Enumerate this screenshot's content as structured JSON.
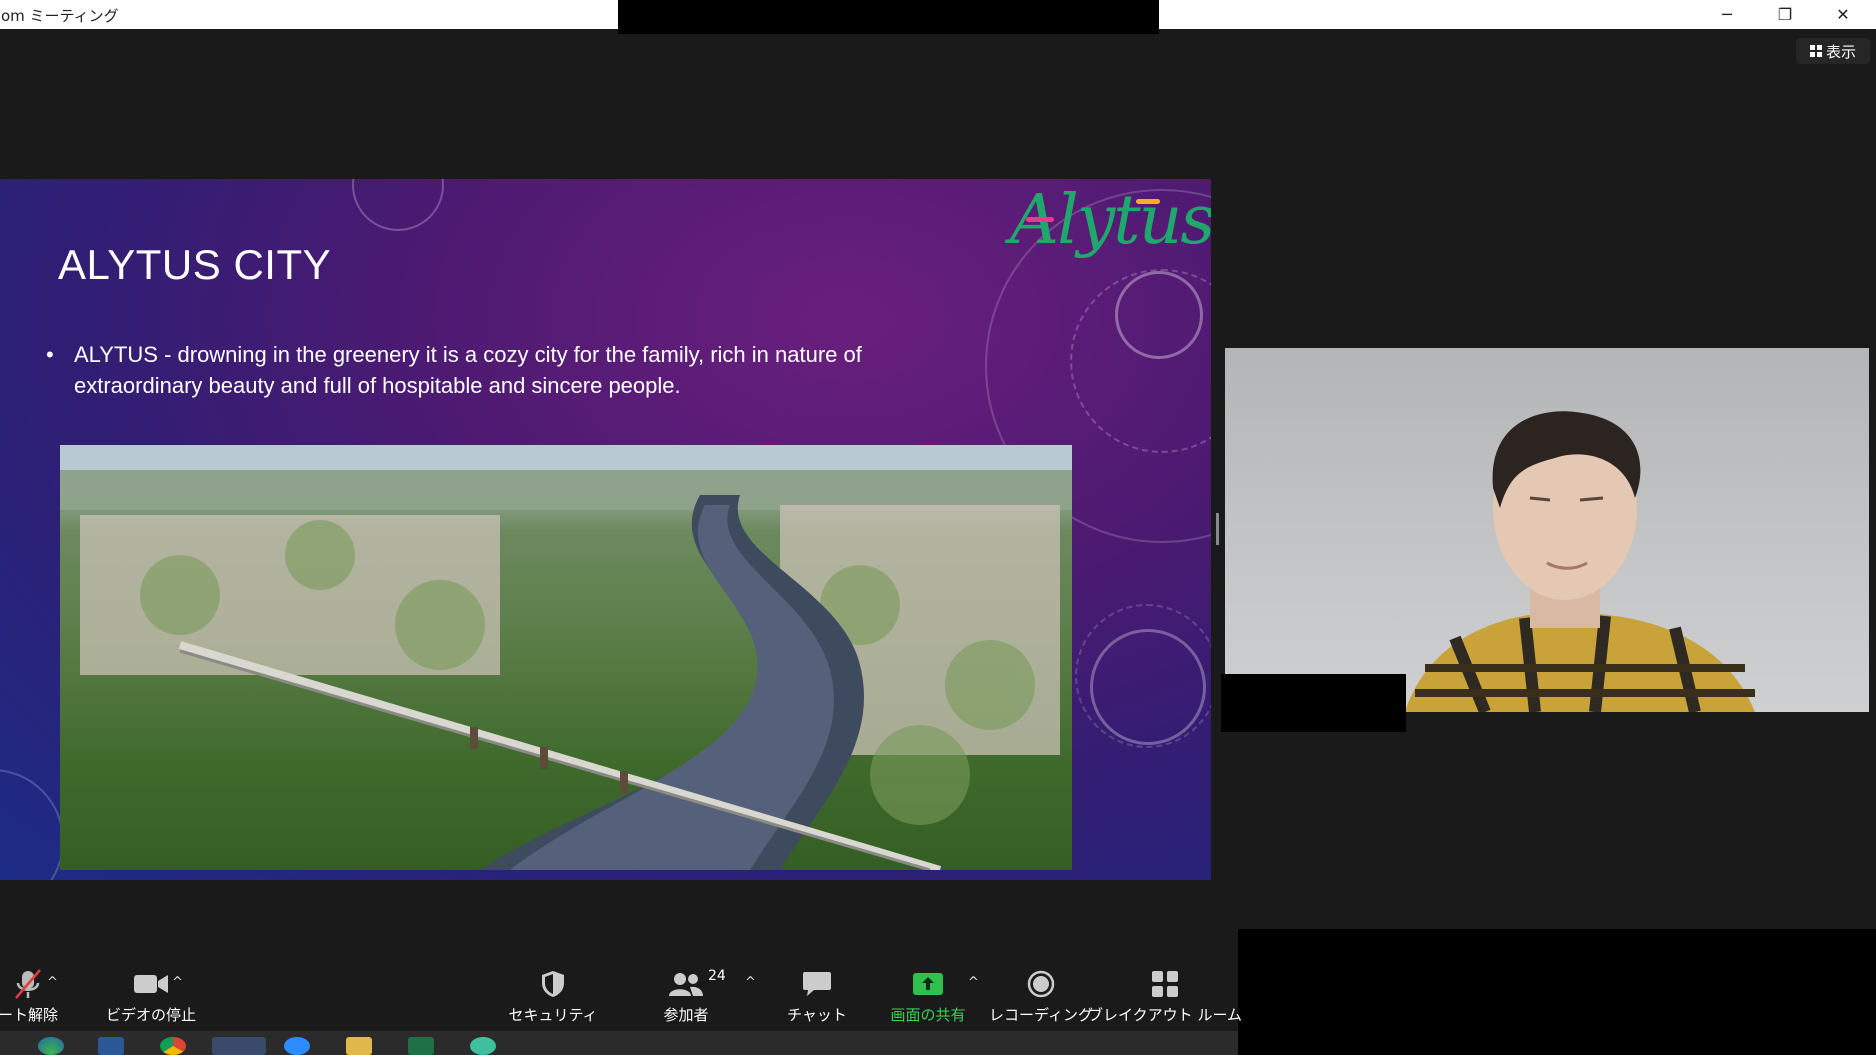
{
  "window": {
    "title": "om ミーティング",
    "view_label": "表示",
    "minimize_glyph": "─",
    "restore_glyph": "❐",
    "close_glyph": "✕"
  },
  "slide": {
    "title": "ALYTUS CITY",
    "bullet": "ALYTUS - drowning in the greenery it is a cozy city for the family, rich in nature of extraordinary beauty and full of hospitable and sincere people.",
    "bullet_marker": "•",
    "logo_text": "Alytus"
  },
  "toolbar": {
    "mute_label": "ート解除",
    "video_label": "ビデオの停止",
    "security_label": "セキュリティ",
    "participants_label": "参加者",
    "participants_count": "24",
    "chat_label": "チャット",
    "share_label": "画面の共有",
    "record_label": "レコーディング",
    "breakout_label": "ブレイクアウト ルーム",
    "caret_glyph": "^"
  },
  "colors": {
    "share_green": "#39d353",
    "slide_purple": "#4d1a72",
    "slide_blue": "#1c2c86",
    "logo_green": "#1ea86b"
  }
}
